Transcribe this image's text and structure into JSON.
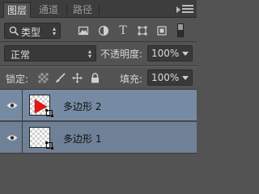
{
  "tabs": [
    "图层",
    "通道",
    "路径"
  ],
  "filter": {
    "label": "类型",
    "icon": "search-icon"
  },
  "blend_mode": "正常",
  "opacity": {
    "label": "不透明度:",
    "value": "100%"
  },
  "lock": {
    "label": "锁定:"
  },
  "fill": {
    "label": "填充:",
    "value": "100%"
  },
  "layers": [
    {
      "name": "多边形 2",
      "selected": true
    },
    {
      "name": "多边形 1",
      "selected": false
    }
  ],
  "colors": {
    "selected_layer": "#768ba3",
    "shape_red": "#e01818"
  }
}
